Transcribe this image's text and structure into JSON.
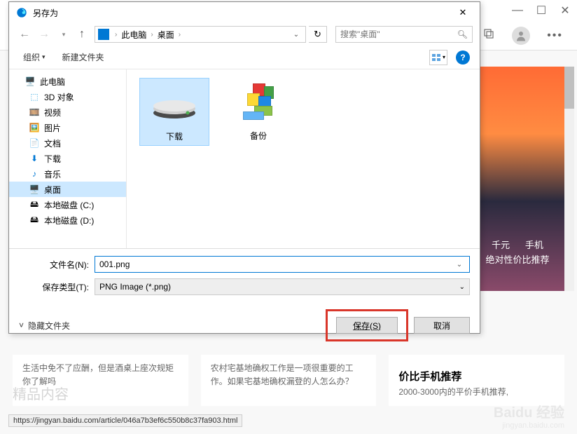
{
  "dialog": {
    "title": "另存为",
    "close": "✕",
    "breadcrumbs": [
      "此电脑",
      "桌面"
    ],
    "search_placeholder": "搜索\"桌面\"",
    "organize": "组织",
    "new_folder": "新建文件夹",
    "help": "?",
    "tree": {
      "root": "此电脑",
      "items": [
        "3D 对象",
        "视频",
        "图片",
        "文档",
        "下载",
        "音乐",
        "桌面",
        "本地磁盘 (C:)",
        "本地磁盘 (D:)"
      ]
    },
    "files": {
      "download": "下载",
      "backup": "备份"
    },
    "filename_label": "文件名(N):",
    "filename_value": "001.png",
    "filetype_label": "保存类型(T):",
    "filetype_value": "PNG Image (*.png)",
    "hide_folders": "隐藏文件夹",
    "save": "保存(S)",
    "cancel": "取消"
  },
  "background": {
    "right_text1": "千元      手机",
    "right_text2": "绝对性价比推荐",
    "card1": "生活中免不了应酬，但是酒桌上座次规矩你了解吗",
    "card2": "农村宅基地确权工作是一项很重要的工作。如果宅基地确权漏登的人怎么办？",
    "card3_title": "价比手机推荐",
    "card3_sub": "2000-3000内的平价手机推荐,",
    "status": "https://jingyan.baidu.com/article/046a7b3ef6c550b8c37fa903.html",
    "watermark": "Baidu 经验",
    "watermark_sub": "jingyan.baidu.com",
    "truncated": "精品内容"
  }
}
